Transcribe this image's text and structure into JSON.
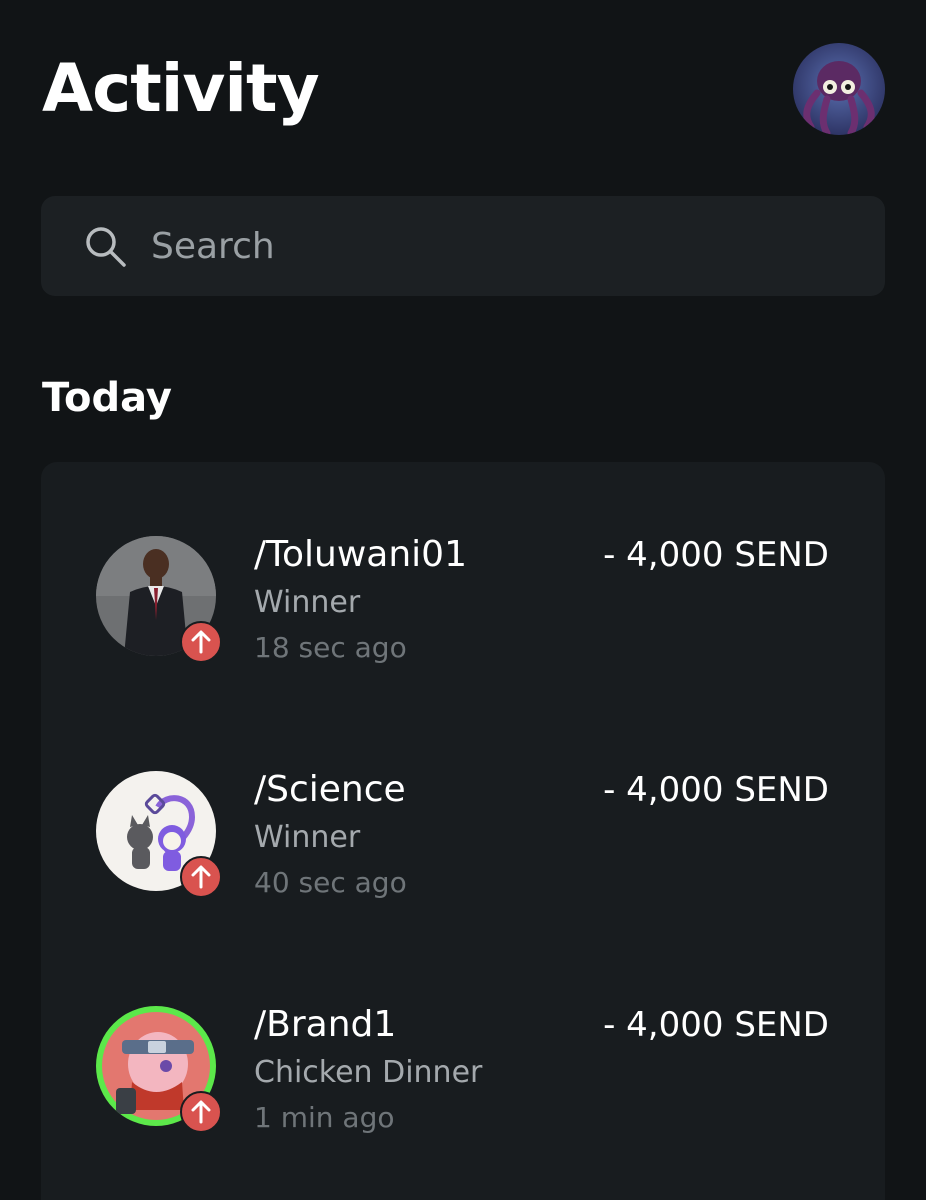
{
  "header": {
    "title": "Activity",
    "profile_avatar": "octopus-avatar"
  },
  "search": {
    "placeholder": "Search",
    "value": ""
  },
  "sections": [
    {
      "title": "Today",
      "items": [
        {
          "name": "/Toluwani01",
          "note": "Winner",
          "time": "18 sec ago",
          "amount": "- 4,000 SEND",
          "avatar": "person-in-suit-photo",
          "direction_icon": "arrow-up-icon"
        },
        {
          "name": "/Science",
          "note": "Winner",
          "time": "40 sec ago",
          "amount": "- 4,000 SEND",
          "avatar": "cartoon-animals-avatar",
          "direction_icon": "arrow-up-icon"
        },
        {
          "name": "/Brand1",
          "note": "Chicken Dinner",
          "time": "1 min ago",
          "amount": "- 4,000 SEND",
          "avatar": "anime-ninja-avatar",
          "direction_icon": "arrow-up-icon"
        }
      ]
    }
  ],
  "colors": {
    "background": "#111416",
    "card": "#181c1f",
    "search": "#1c2023",
    "badge": "#d9534f",
    "highlight_ring": "#5ce84a"
  }
}
